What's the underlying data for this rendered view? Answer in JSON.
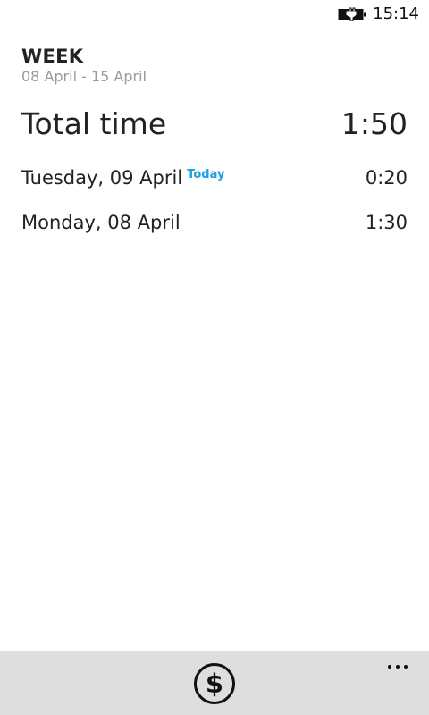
{
  "status_bar": {
    "time": "15:14",
    "battery_icon": "battery-charging-icon"
  },
  "header": {
    "title": "WEEK",
    "date_range": "08 April - 15 April"
  },
  "summary": {
    "label": "Total time",
    "value": "1:50"
  },
  "days": [
    {
      "label": "Tuesday, 09 April",
      "badge": "Today",
      "value": "0:20"
    },
    {
      "label": "Monday, 08 April",
      "badge": "",
      "value": "1:30"
    }
  ],
  "app_bar": {
    "primary_icon": "dollar-icon",
    "more_icon": "ellipsis-icon",
    "background": "#dedede"
  },
  "colors": {
    "accent": "#1ba1e2",
    "subtitle": "#9a9a9a"
  }
}
